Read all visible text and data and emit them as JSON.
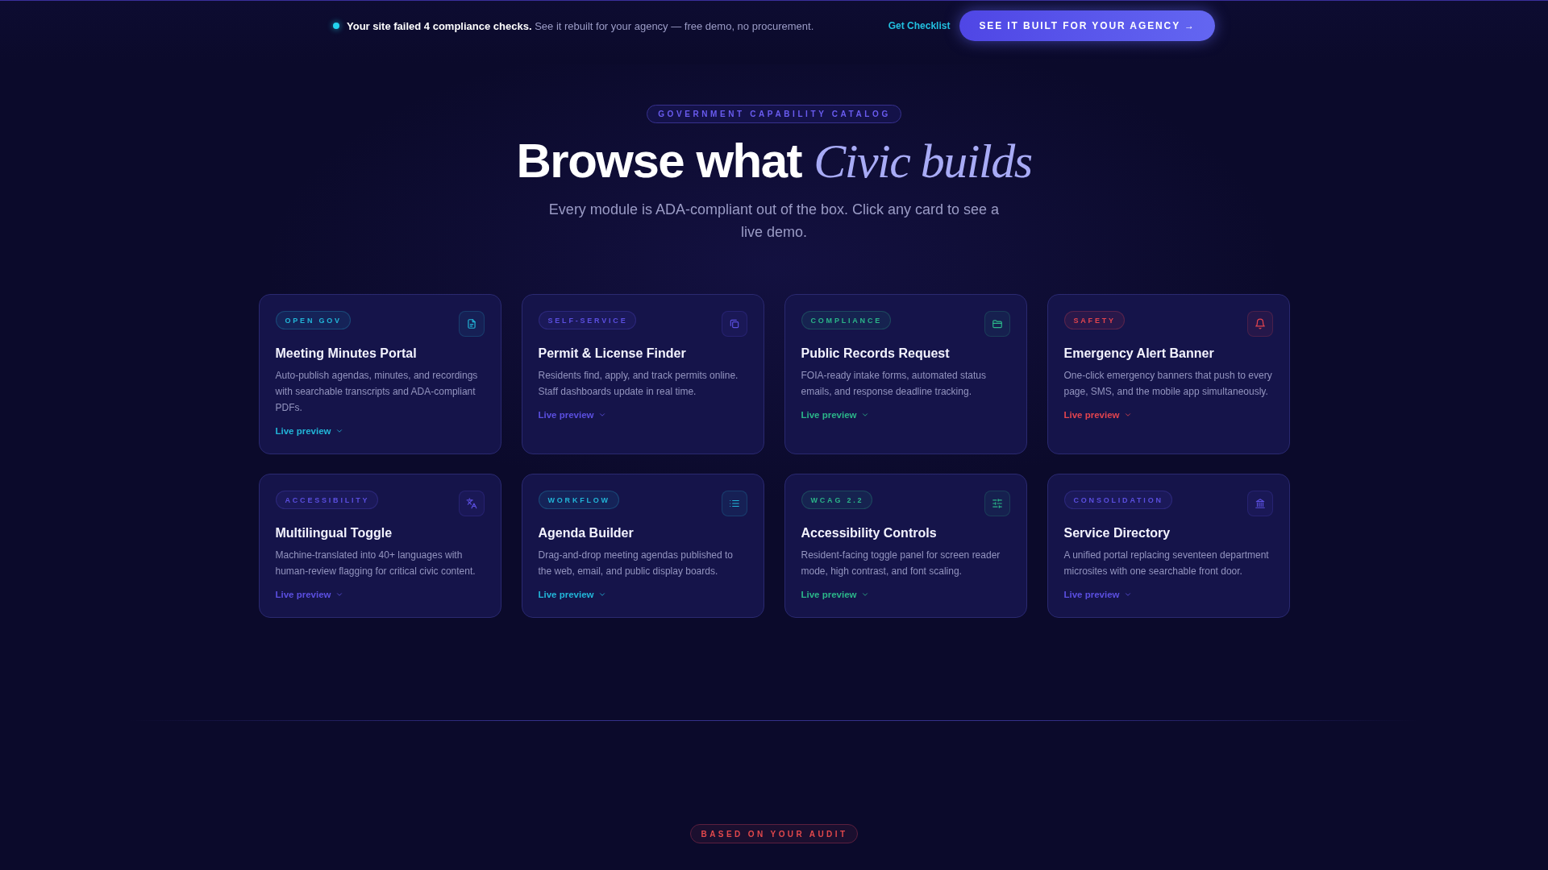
{
  "notice_bar": {
    "message": "**Your site failed 4 compliance checks.** See it rebuilt for your agency — free demo, no procurement.",
    "link": "Get Checklist",
    "button": "SEE IT BUILT FOR YOUR AGENCY →"
  },
  "hero": {
    "eyebrow": "GOVERNMENT CAPABILITY CATALOG",
    "title": "Browse what *Civic builds*",
    "subtitle": "Every module is ADA-compliant out of the box. Click any card to see a live demo."
  },
  "cards": [
    {
      "tag": "OPEN GOV",
      "title": "Meeting Minutes Portal",
      "description": "Auto-publish agendas, minutes, and recordings with searchable transcripts and ADA-compliant PDFs.",
      "link": "Live preview",
      "color": "#22b5d8"
    },
    {
      "tag": "SELF-SERVICE",
      "title": "Permit & License Finder",
      "description": "Residents find, apply, and track permits online. Staff dashboards update in real time.",
      "link": "Live preview",
      "color": "#5b4fe0"
    },
    {
      "tag": "COMPLIANCE",
      "title": "Public Records Request",
      "description": "FOIA-ready intake forms, automated status emails, and response deadline tracking.",
      "link": "Live preview",
      "color": "#2bb589"
    },
    {
      "tag": "SAFETY",
      "title": "Emergency Alert Banner",
      "description": "One-click emergency banners that push to every page, SMS, and the mobile app simultaneously.",
      "link": "Live preview",
      "color": "#e2444e"
    },
    {
      "tag": "ACCESSIBILITY",
      "title": "Multilingual Toggle",
      "description": "Machine-translated into 40+ languages with human-review flagging for critical civic content.",
      "link": "Live preview",
      "color": "#5b4fe0"
    },
    {
      "tag": "WORKFLOW",
      "title": "Agenda Builder",
      "description": "Drag-and-drop meeting agendas published to the web, email, and public display boards.",
      "link": "Live preview",
      "color": "#22b5d8"
    },
    {
      "tag": "WCAG 2.2",
      "title": "Accessibility Controls",
      "description": "Resident-facing toggle panel for screen reader mode, high contrast, and font scaling.",
      "link": "Live preview",
      "color": "#2bb589"
    },
    {
      "tag": "CONSOLIDATION",
      "title": "Service Directory",
      "description": "A unified portal replacing seventeen department microsites with one searchable front door.",
      "link": "Live preview",
      "color": "#5b4fe0"
    }
  ],
  "next_section": {
    "eyebrow": "BASED ON YOUR AUDIT"
  }
}
